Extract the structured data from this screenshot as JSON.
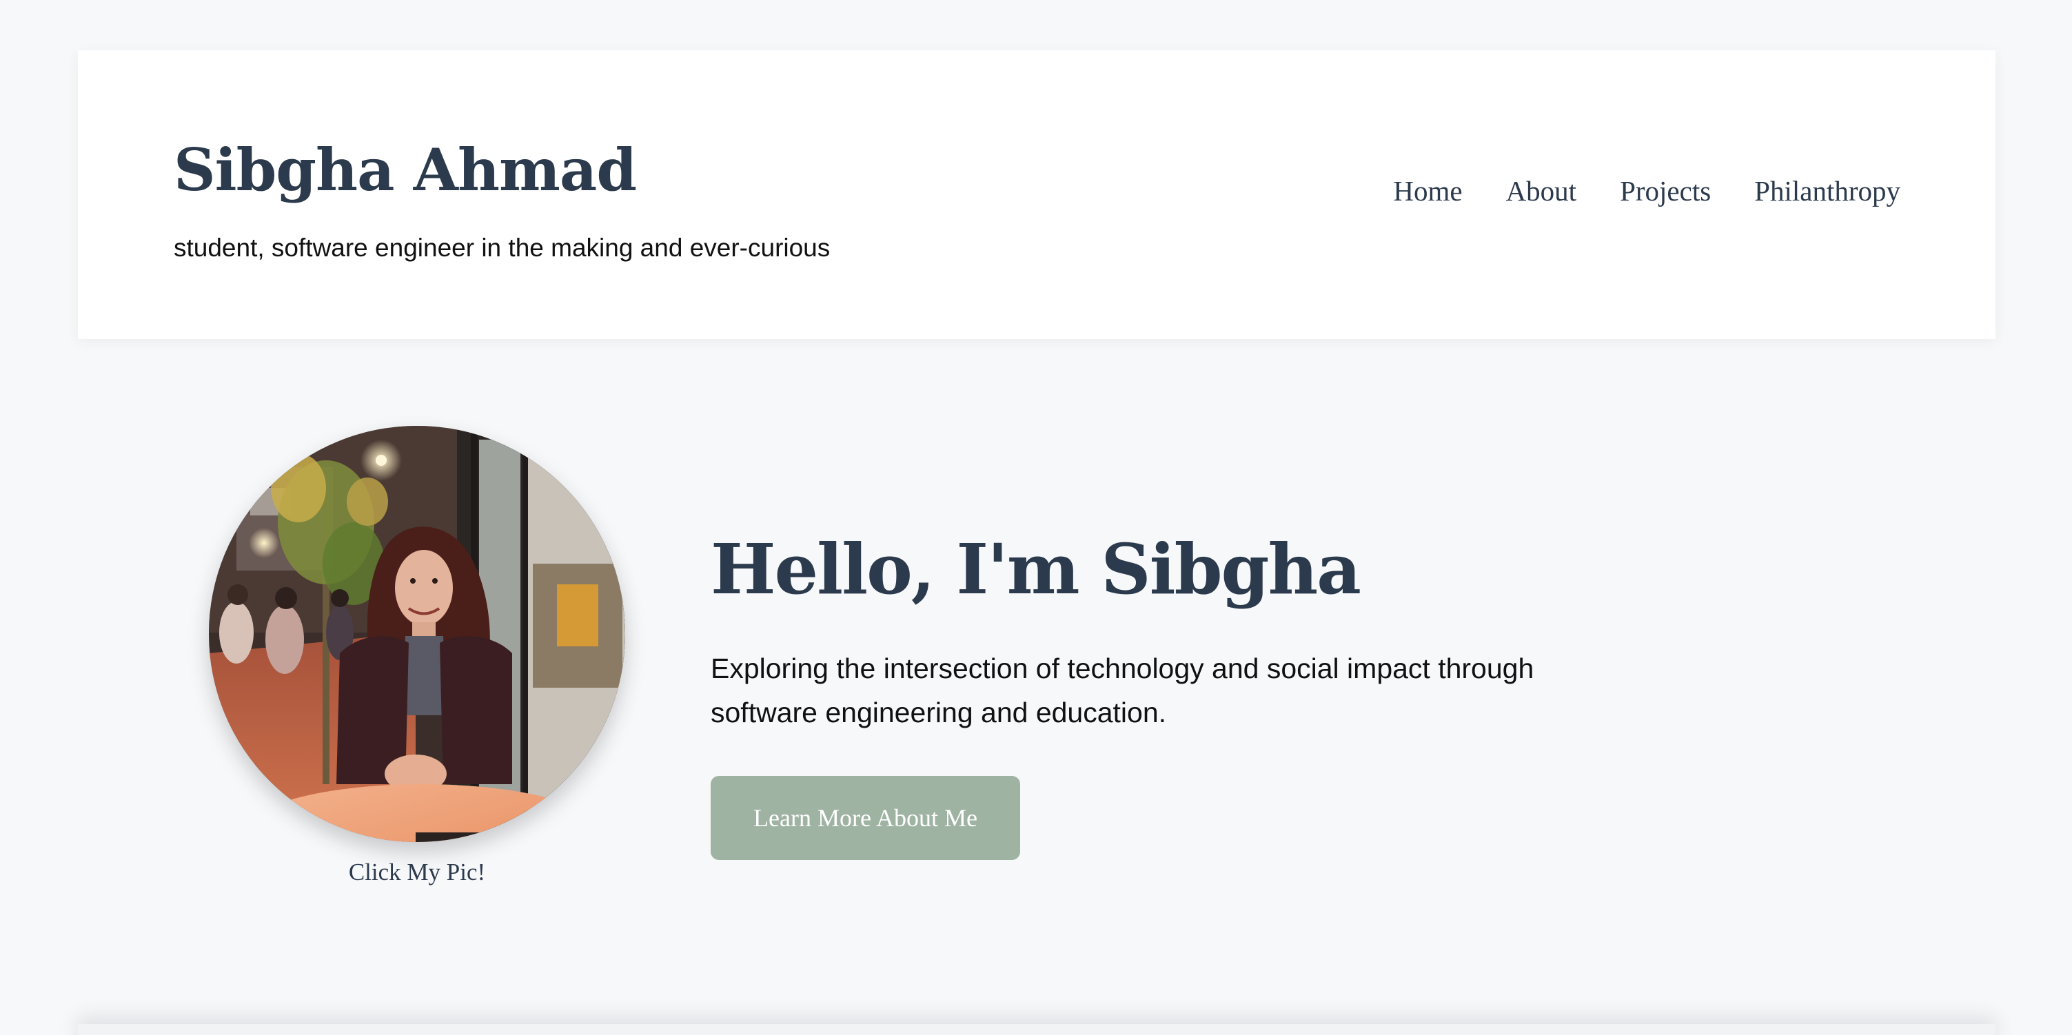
{
  "header": {
    "site_title": "Sibgha Ahmad",
    "tagline": "student, software engineer in the making and ever-curious",
    "nav": [
      {
        "label": "Home"
      },
      {
        "label": "About"
      },
      {
        "label": "Projects"
      },
      {
        "label": "Philanthropy"
      }
    ]
  },
  "hero": {
    "heading": "Hello, I'm Sibgha",
    "intro": "Exploring the intersection of technology and social impact through software engineering and education.",
    "cta_label": "Learn More About Me",
    "photo_caption": "Click My Pic!"
  },
  "colors": {
    "page_background": "#f7f8f9",
    "header_background": "#ffffff",
    "heading_text": "#2c3a4d",
    "body_text": "#111111",
    "button_background": "#9fb3a3",
    "button_text": "#ffffff"
  }
}
